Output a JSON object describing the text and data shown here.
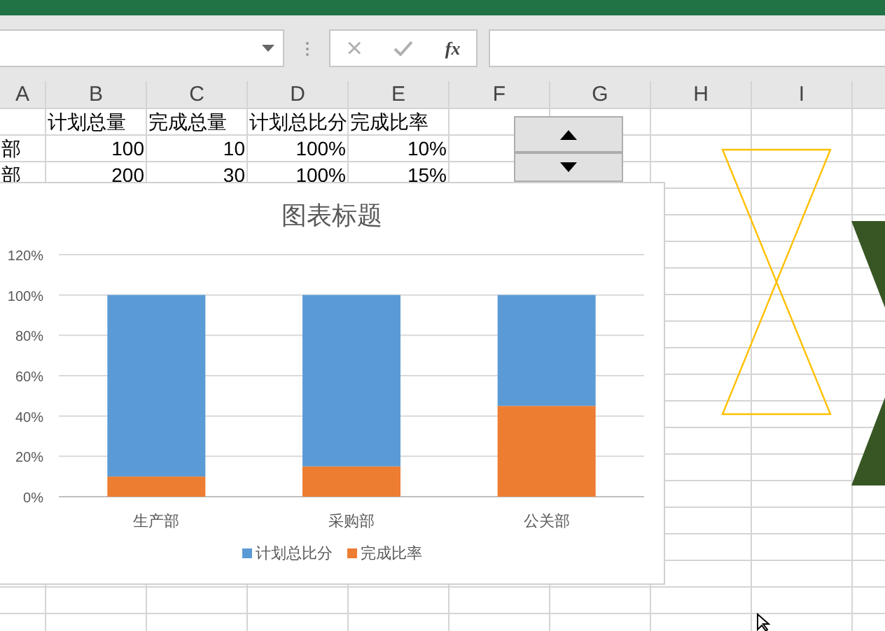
{
  "formula_bar": {
    "cancel": "×",
    "fx": "fx"
  },
  "column_headers": [
    "A",
    "B",
    "C",
    "D",
    "E",
    "F",
    "G",
    "H",
    "I"
  ],
  "rows": [
    {
      "kind": "header",
      "cells": [
        "",
        "计划总量",
        "完成总量",
        "计划总比分",
        "完成比率"
      ]
    },
    {
      "kind": "data",
      "cells": [
        "部",
        "100",
        "10",
        "100%",
        "10%"
      ]
    },
    {
      "kind": "data",
      "cells": [
        "部",
        "200",
        "30",
        "100%",
        "15%"
      ]
    }
  ],
  "chart": {
    "chart_data": {
      "type": "bar",
      "title": "图表标题",
      "categories": [
        "生产部",
        "采购部",
        "公关部"
      ],
      "series": [
        {
          "name": "计划总比分",
          "color": "#5b9bd5",
          "values": [
            90,
            85,
            55
          ]
        },
        {
          "name": "完成比率",
          "color": "#ed7d31",
          "values": [
            10,
            15,
            45
          ]
        }
      ],
      "ylim": [
        0,
        120
      ],
      "yticks": [
        {
          "value": 0,
          "label": "0%"
        },
        {
          "value": 20,
          "label": "20%"
        },
        {
          "value": 40,
          "label": "40%"
        },
        {
          "value": 60,
          "label": "60%"
        },
        {
          "value": 80,
          "label": "80%"
        },
        {
          "value": 100,
          "label": "100%"
        },
        {
          "value": 120,
          "label": "120%"
        }
      ],
      "stacked": true,
      "grid": true,
      "legend": "bottom"
    }
  }
}
